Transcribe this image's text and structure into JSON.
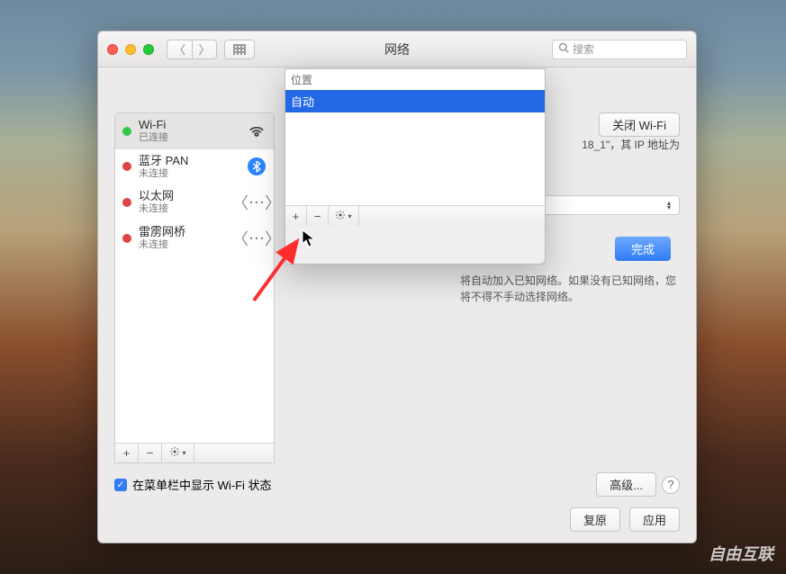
{
  "titlebar": {
    "title": "网络",
    "search_placeholder": "搜索"
  },
  "sidebar": {
    "items": [
      {
        "name": "Wi-Fi",
        "status": "已连接"
      },
      {
        "name": "蓝牙 PAN",
        "status": "未连接"
      },
      {
        "name": "以太网",
        "status": "未连接"
      },
      {
        "name": "雷雳网桥",
        "status": "未连接"
      }
    ]
  },
  "main": {
    "wifi_off_btn": "关闭 Wi-Fi",
    "ip_text": "18_1\"，其 IP 地址为",
    "done_btn": "完成",
    "hint": "将自动加入已知网络。如果没有已知网络，您将不得不手动选择网络。"
  },
  "sheet": {
    "header": "位置",
    "selected": "自动"
  },
  "footer": {
    "checkbox_label": "在菜单栏中显示 Wi-Fi 状态",
    "advanced": "高级...",
    "revert": "复原",
    "apply": "应用"
  },
  "watermark": "自由互联"
}
